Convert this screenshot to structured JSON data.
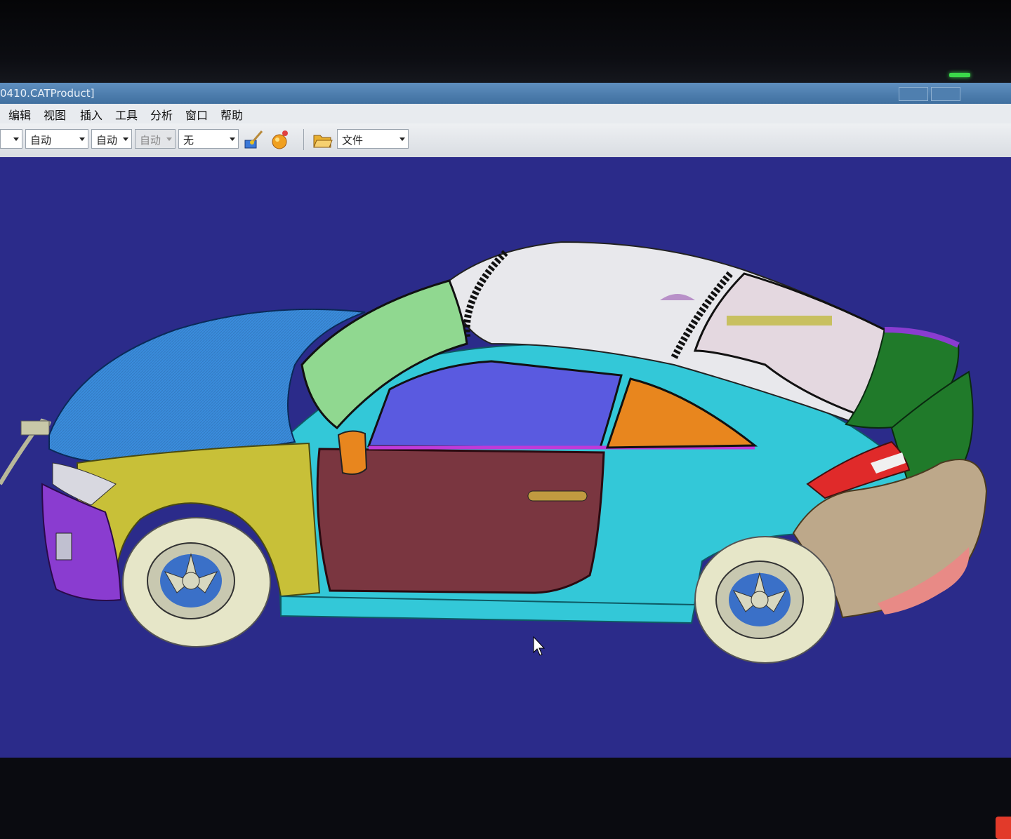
{
  "window": {
    "title": "0410.CATProduct]"
  },
  "menu": [
    "编辑",
    "视图",
    "插入",
    "工具",
    "分析",
    "窗口",
    "帮助"
  ],
  "toolbar": {
    "combo_auto": "自动",
    "combo_auto2": "自动",
    "combo_auto3": "自动",
    "combo_none": "无",
    "combo_file": "文件"
  },
  "icons": {
    "paint": "paint-brush-icon",
    "material": "apply-material-icon",
    "open": "open-folder-icon",
    "cursor": "mouse-pointer-icon"
  },
  "colors": {
    "viewport_bg": "#2b2b8a",
    "body_cyan": "#33c8d8",
    "hood_blue": "#3a8cdc",
    "fender_yellow": "#c8c038",
    "door_maroon": "#7a3640",
    "bumper_purple": "#8a3cd0",
    "rear_tan": "#bda88a",
    "spoiler_green": "#207a2a",
    "quarter_window_orange": "#e8861e",
    "taillight_red": "#e02a2a",
    "tire_cream": "#e6e6c8"
  }
}
